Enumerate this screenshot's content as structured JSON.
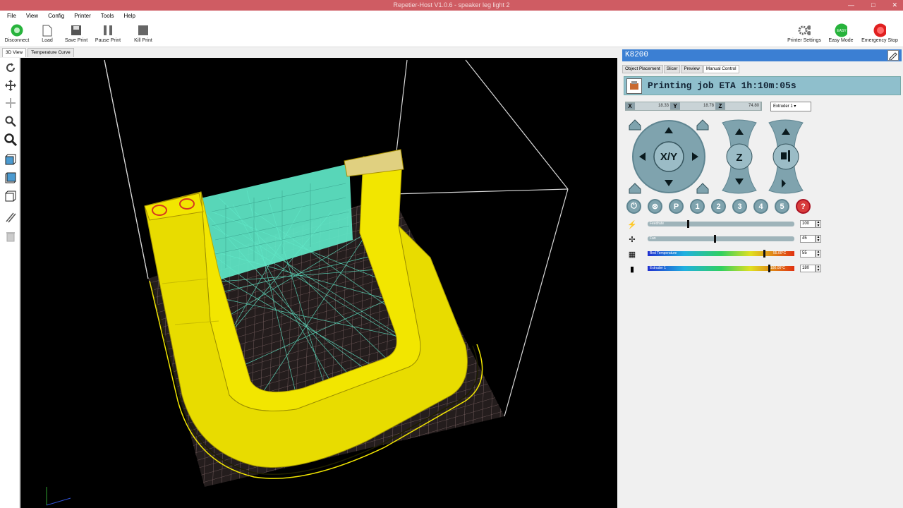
{
  "window": {
    "title": "Repetier-Host V1.0.6 - speaker leg light 2",
    "minimize": "—",
    "maximize": "□",
    "close": "✕"
  },
  "menu": [
    "File",
    "View",
    "Config",
    "Printer",
    "Tools",
    "Help"
  ],
  "toolbar": {
    "disconnect": "Disconnect",
    "load": "Load",
    "save_print": "Save Print",
    "pause_print": "Pause Print",
    "kill_print": "Kill Print",
    "printer_settings": "Printer Settings",
    "easy_mode": "Easy Mode",
    "emergency_stop": "Emergency Stop"
  },
  "view_tabs": [
    "3D View",
    "Temperature Curve"
  ],
  "panel": {
    "printer_name": "K8200",
    "tabs": [
      "Object Placement",
      "Slicer",
      "Preview",
      "Manual Control"
    ],
    "active_tab": "Manual Control",
    "status": "Printing job ETA 1h:10m:05s",
    "coords": {
      "x_label": "X",
      "x_value": "18.33",
      "y_label": "Y",
      "y_value": "18.78",
      "z_label": "Z",
      "z_value": "74.80"
    },
    "extruder_select": "Extruder 1",
    "xy_label": "X/Y",
    "z_label": "Z",
    "round_buttons": [
      "⏻",
      "⊛",
      "P",
      "1",
      "2",
      "3",
      "4",
      "5",
      "?"
    ],
    "sliders": {
      "feedrate": {
        "label": "Feedrate",
        "value": "100",
        "level": 0.27
      },
      "fan": {
        "label": "Fan",
        "value": "45",
        "level": 0.45
      },
      "bed": {
        "label": "Bed Temperature",
        "value": "55",
        "reading": "55.00°C",
        "level": 0.79
      },
      "extruder": {
        "label": "Extruder 1",
        "value": "180",
        "reading": "180.00°C",
        "level": 0.82
      }
    }
  },
  "colors": {
    "titlebar": "#cf5c63",
    "panel_header": "#3b7fd3",
    "status_bg": "#8fbfcc",
    "model_yellow": "#f2e600",
    "travel_cyan": "#5fe8c8",
    "disconnect_green": "#27b33c",
    "stop_red": "#e02020"
  },
  "icons": [
    "refresh-icon",
    "move-icon",
    "pan-icon",
    "zoom-in-icon",
    "zoom-fit-icon",
    "view-front-icon",
    "view-top-icon",
    "view-iso-icon",
    "parallel-lines-icon",
    "trash-icon"
  ]
}
